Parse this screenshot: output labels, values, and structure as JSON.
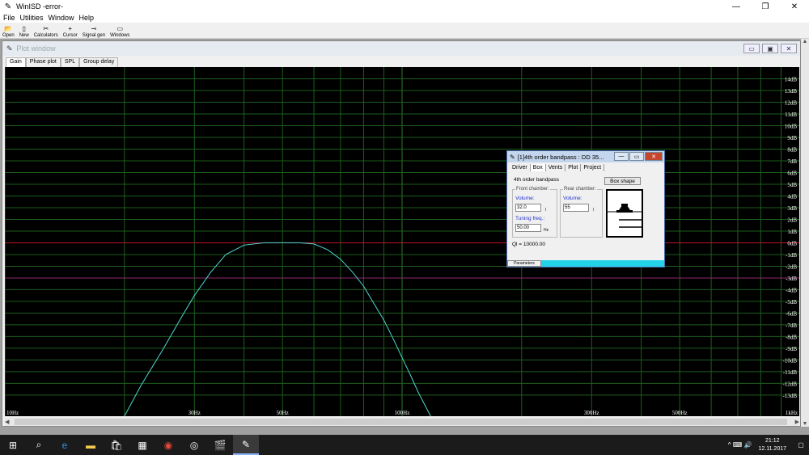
{
  "window": {
    "title": "WinISD -error-",
    "minimize": "—",
    "maximize": "❐",
    "close": "✕"
  },
  "menu": [
    "File",
    "Utilities",
    "Window",
    "Help"
  ],
  "toolbar": [
    {
      "label": "Open",
      "icon": "folder-icon"
    },
    {
      "label": "New",
      "icon": "new-doc-icon"
    },
    {
      "label": "Calculators",
      "icon": "calculator-icon"
    },
    {
      "label": "Cursor",
      "icon": "crosshair-icon"
    },
    {
      "label": "Signal gen",
      "icon": "signal-gen-icon"
    },
    {
      "label": "Windows",
      "icon": "windows-icon"
    }
  ],
  "plot_window": {
    "title": "Plot window",
    "tabs": [
      "Gain",
      "Phase plot",
      "SPL",
      "Group delay"
    ],
    "active_tab": "Gain"
  },
  "chart_data": {
    "type": "line",
    "xscale": "log",
    "xlim": [
      10,
      1000
    ],
    "ylim": [
      -14.8,
      15
    ],
    "x_ticks": [
      10,
      30,
      50,
      100,
      300,
      500,
      1000
    ],
    "x_tick_labels": [
      "10Hz",
      "30Hz",
      "50Hz",
      "100Hz",
      "300Hz",
      "500Hz",
      "1kHz"
    ],
    "y_ticks": [
      14,
      13,
      12,
      11,
      10,
      9,
      8,
      7,
      6,
      5,
      4,
      3,
      2,
      1,
      0,
      -1,
      -2,
      -3,
      -4,
      -5,
      -6,
      -7,
      -8,
      -9,
      -10,
      -11,
      -12,
      -13
    ],
    "y_tick_labels": [
      "14dB",
      "13dB",
      "12dB",
      "11dB",
      "10dB",
      "9dB",
      "8dB",
      "7dB",
      "6dB",
      "5dB",
      "4dB",
      "3dB",
      "2dB",
      "1dB",
      "0dB",
      "-1dB",
      "-2dB",
      "-3dB",
      "-4dB",
      "-5dB",
      "-6dB",
      "-7dB",
      "-8dB",
      "-9dB",
      "-10dB",
      "-11dB",
      "-12dB",
      "-13dB"
    ],
    "reference_lines": [
      {
        "y": 0,
        "color": "#c0142b"
      },
      {
        "y": -3,
        "color": "#8a2a6a"
      }
    ],
    "grid": true,
    "series": [
      {
        "color": "#4fd7d0",
        "x": [
          20,
          22,
          25,
          28,
          30,
          33,
          36,
          40,
          45,
          50,
          55,
          60,
          65,
          70,
          75,
          80,
          85,
          90,
          95,
          100,
          105,
          110,
          118
        ],
        "y": [
          -14.8,
          -12.2,
          -9.1,
          -6.2,
          -4.5,
          -2.5,
          -1.0,
          -0.2,
          0.0,
          0.0,
          0.0,
          -0.1,
          -0.6,
          -1.4,
          -2.5,
          -3.7,
          -5.2,
          -6.6,
          -8.2,
          -9.8,
          -11.3,
          -12.8,
          -14.8
        ]
      }
    ]
  },
  "dialog": {
    "title": "[1]4th order bandpass : DD 35...",
    "tabs": [
      "Driver",
      "Box",
      "Vents",
      "Plot",
      "Project"
    ],
    "active_tab": "Box",
    "box_type": "4th order bandpass",
    "box_shape_button": "Box shape",
    "front_chamber": {
      "label": "Front chamber:",
      "volume_label": "Volume:",
      "volume_value": "32.0",
      "volume_unit": "l",
      "tuning_label": "Tuning freq.:",
      "tuning_value": "50.00",
      "tuning_unit": "Hz"
    },
    "rear_chamber": {
      "label": "Rear chamber:",
      "volume_label": "Volume:",
      "volume_value": "55",
      "volume_unit": "l"
    },
    "ql": "Ql = 10000.00",
    "status_segment": "Parameters"
  },
  "taskbar": {
    "apps": [
      "windows-icon",
      "search-icon",
      "edge-icon",
      "file-explorer-icon",
      "store-icon",
      "calculator-icon",
      "chrome-icon",
      "media-icon",
      "film-icon",
      "winisd-icon"
    ],
    "time": "21:12",
    "date": "12.11.2017",
    "tray_icons": "^ ⌨ 🔊"
  }
}
